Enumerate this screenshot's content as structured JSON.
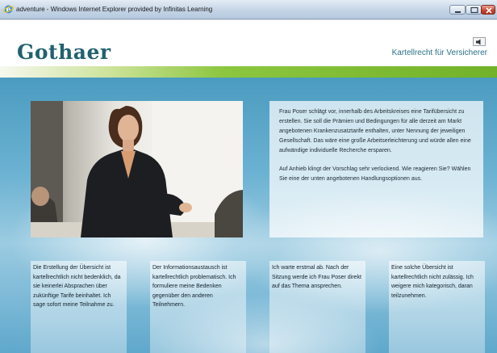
{
  "window": {
    "title": "adventure - Windows Internet Explorer provided by Infinitas Learning"
  },
  "header": {
    "logo_text": "Gothaer",
    "module_title": "Kartellrecht für Versicherer"
  },
  "scenario": {
    "paragraph1": "Frau Poser schlägt vor, innerhalb des Arbeitskreises eine Tarifübersicht zu erstellen. Sie soll die Prämien und Bedingungen für alle derzeit am Markt angebotenen Krankenzusatztarife enthalten, unter Nennung der jeweiligen Gesellschaft. Das wäre eine große Arbeitserleichterung und würde allen eine aufwändige individuelle Recherche ersparen.",
    "paragraph2": "Auf Anhieb klingt der Vorschlag sehr verlockend. Wie reagieren Sie? Wählen Sie eine der unten angebotenen Handlungsoptionen aus."
  },
  "options": [
    "Die Erstellung der Übersicht ist kartellrechtlich nicht bedenklich, da sie keinerlei Absprachen über zukünftige Tarife beinhaltet. Ich sage sofort meine Teilnahme zu.",
    "Der Informationsaustausch ist kartellrechtlich problematisch. Ich formuliere meine Bedenken gegenüber den anderen Teilnehmern.",
    "Ich warte erstmal ab. Nach der Sitzung werde ich Frau Poser direkt auf das Thema ansprechen.",
    "Eine solche Übersicht ist kartellrechtlich nicht zulässig. Ich weigere mich kategorisch, daran teilzunehmen."
  ],
  "colors": {
    "brand_teal": "#21616f",
    "module_title": "#2a6f8a",
    "accent_green": "#8cc63f",
    "stage_blue": "#6cb2d2"
  },
  "icons": {
    "browser": "ie-icon",
    "audio": "speaker-icon",
    "window_controls": [
      "minimize-icon",
      "maximize-icon",
      "close-icon"
    ]
  }
}
